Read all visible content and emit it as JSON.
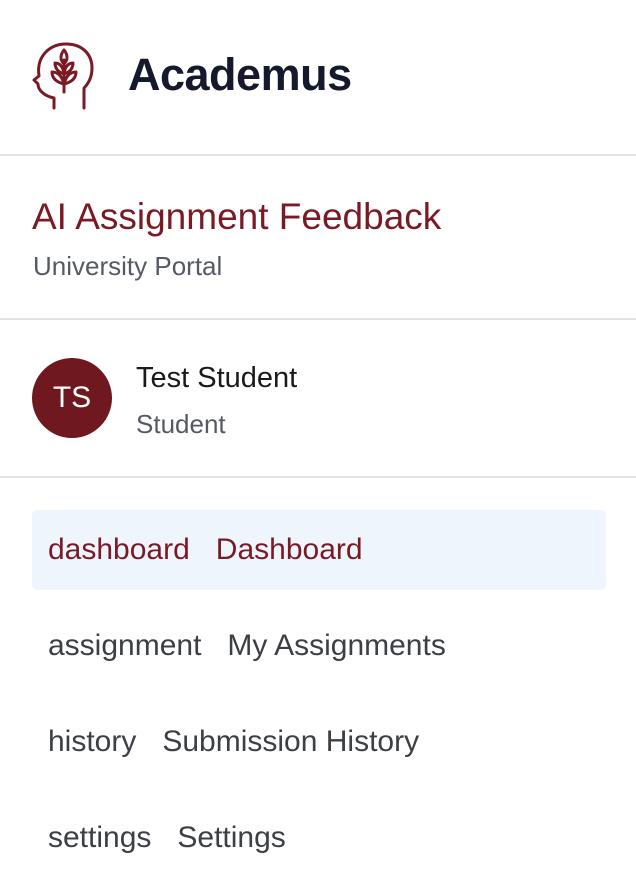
{
  "brand": {
    "name": "Academus",
    "logo_icon": "head-with-plant-icon",
    "color": "#7a1a25"
  },
  "portal": {
    "title": "AI Assignment Feedback",
    "subtitle": "University Portal"
  },
  "user": {
    "initials": "TS",
    "name": "Test Student",
    "role": "Student",
    "avatar_color": "#701820"
  },
  "nav": {
    "items": [
      {
        "icon": "dashboard",
        "label": "Dashboard",
        "active": true
      },
      {
        "icon": "assignment",
        "label": "My Assignments",
        "active": false
      },
      {
        "icon": "history",
        "label": "Submission History",
        "active": false
      },
      {
        "icon": "settings",
        "label": "Settings",
        "active": false
      }
    ]
  },
  "colors": {
    "accent": "#7a1a25",
    "active_bg": "#eef5fd",
    "divider": "#e3e3e6"
  }
}
